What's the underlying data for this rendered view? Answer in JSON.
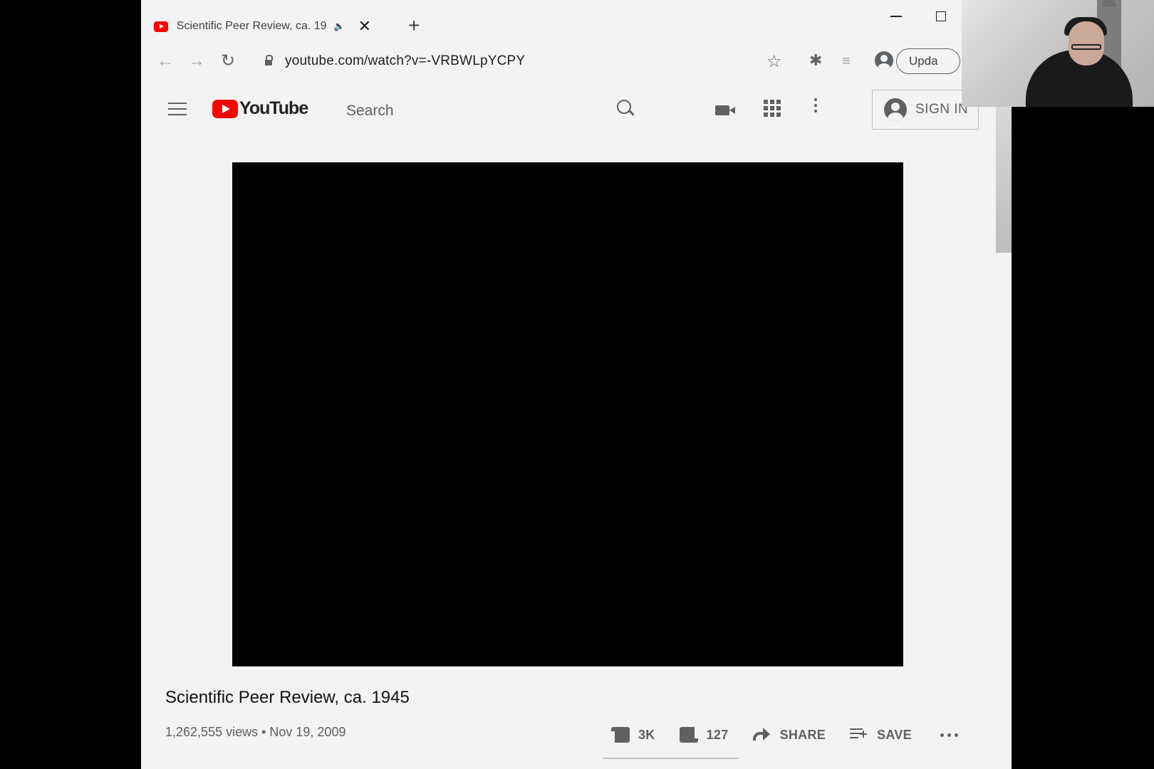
{
  "browser": {
    "tab": {
      "title": "Scientific Peer Review, ca. 19",
      "audio_icon": "speaker-icon",
      "close_glyph": "✕"
    },
    "new_tab_glyph": "+",
    "address": {
      "url": "youtube.com/watch?v=-VRBWLpYCPY"
    },
    "update_button": "Upda"
  },
  "youtube": {
    "logo_text": "YouTube",
    "search": {
      "placeholder": "Search"
    },
    "sign_in": "SIGN IN"
  },
  "video": {
    "title": "Scientific Peer Review, ca. 1945",
    "meta": "1,262,555 views • Nov 19, 2009",
    "likes": "3K",
    "dislikes": "127",
    "share": "SHARE",
    "save": "SAVE"
  },
  "colors": {
    "brand_red": "#ff0000",
    "page_bg": "#f3f3f3",
    "icon_gray": "#606060"
  }
}
